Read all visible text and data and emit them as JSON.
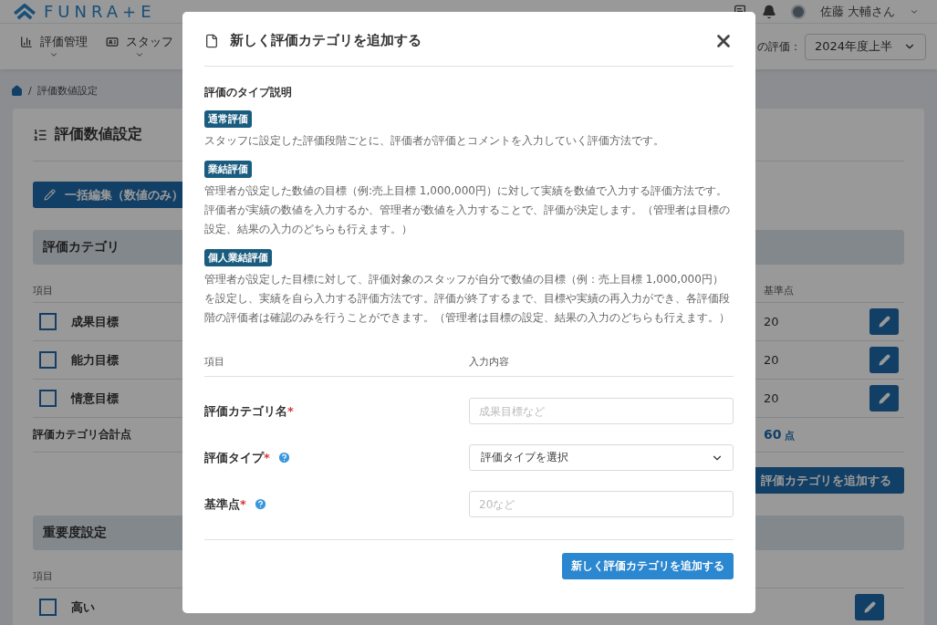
{
  "header": {
    "logo": "FUNRA+E",
    "user": "佐藤 大輔さん"
  },
  "nav": {
    "items": [
      {
        "label": "評価管理",
        "kind": "chart"
      },
      {
        "label": "スタッフ",
        "kind": "staff"
      }
    ],
    "period_label": "の評価：",
    "period": "2024年度上半"
  },
  "breadcrumb": {
    "separator": "/",
    "items": [
      "評価数値設定"
    ]
  },
  "page": {
    "title": "評価数値設定",
    "bulk_edit": "一括編集（数値のみ）",
    "categories": {
      "title": "評価カテゴリ",
      "columns": [
        "項目",
        "基準点"
      ],
      "rows": [
        {
          "name": "成果目標",
          "score": "20",
          "checked": false
        },
        {
          "name": "能力目標",
          "score": "20",
          "checked": false
        },
        {
          "name": "情意目標",
          "score": "20",
          "checked": false
        }
      ],
      "total": {
        "label": "評価カテゴリ合計点",
        "value": "60",
        "unit": "点"
      },
      "add_button": "評価カテゴリを追加する"
    },
    "importance": {
      "title": "重要度設定",
      "columns": [
        "項目"
      ],
      "rows": [
        {
          "name": "高い",
          "checked": false
        }
      ]
    }
  },
  "modal": {
    "title": "新しく評価カテゴリを追加する",
    "types_heading": "評価のタイプ説明",
    "types": [
      {
        "tag": "通常評価",
        "description": "スタッフに設定した評価段階ごとに、評価者が評価とコメントを入力していく評価方法です。"
      },
      {
        "tag": "業結評価",
        "description": "管理者が設定した数値の目標（例:売上目標 1,000,000円）に対して実績を数値で入力する評価方法です。評価者が実績の数値を入力するか、管理者が数値を入力することで、評価が決定します。（管理者は目標の設定、結果の入力のどちらも行えます。）"
      },
      {
        "tag": "個人業結評価",
        "description": "管理者が設定した目標に対して、評価対象のスタッフが自分で数値の目標（例：売上目標 1,000,000円）を設定し、実績を自ら入力する評価方法です。評価が終了するまで、目標や実績の再入力ができ、各評価段階の評価者は確認のみを行うことができます。（管理者は目標の設定、結果の入力のどちらも行えます。）"
      }
    ],
    "form_columns": [
      "項目",
      "入力内容"
    ],
    "fields": [
      {
        "label": "評価カテゴリ名",
        "required_mark": "*",
        "help": false,
        "kind": "text",
        "placeholder": "成果目標など"
      },
      {
        "label": "評価タイプ",
        "required_mark": "*",
        "help": true,
        "kind": "select",
        "value": "評価タイプを選択"
      },
      {
        "label": "基準点",
        "required_mark": "*",
        "help": true,
        "kind": "text",
        "placeholder": "20など"
      }
    ],
    "submit": "新しく評価カテゴリを追加する"
  }
}
